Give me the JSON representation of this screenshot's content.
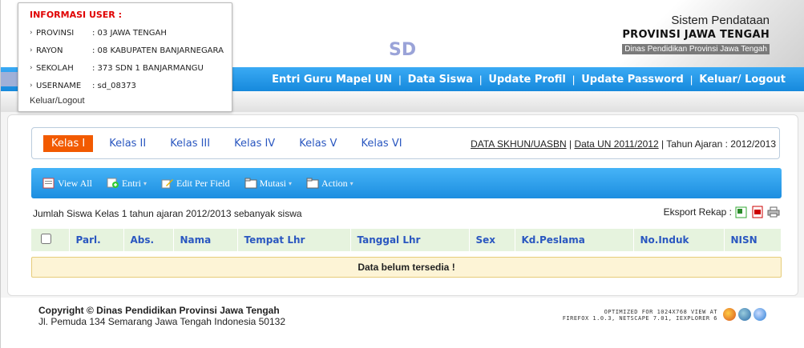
{
  "user_info": {
    "title": "INFORMASI USER :",
    "rows": [
      {
        "label": "PROVINSI",
        "value": ": 03 JAWA TENGAH"
      },
      {
        "label": "RAYON",
        "value": ": 08 KABUPATEN BANJARNEGARA"
      },
      {
        "label": "SEKOLAH",
        "value": ": 373 SDN 1 BANJARMANGU"
      },
      {
        "label": "USERNAME",
        "value": ": sd_08373"
      }
    ],
    "logout_label": "Keluar/Logout"
  },
  "header": {
    "logo_text": "SD",
    "brand_line1": "Sistem Pendataan",
    "brand_line2": "PROVINSI JAWA TENGAH",
    "brand_line3": "Dinas Pendidikan Provinsi Jawa Tengah"
  },
  "top_menu": [
    "Entri Guru Mapel UN",
    "Data Siswa",
    "Update Profil",
    "Update Password",
    "Keluar/ Logout"
  ],
  "tabs": {
    "items": [
      "Kelas I",
      "Kelas II",
      "Kelas III",
      "Kelas IV",
      "Kelas V",
      "Kelas VI"
    ],
    "active_index": 0,
    "links": [
      "DATA SKHUN/UASBN",
      "Data UN 2011/2012"
    ],
    "year_label": "Tahun Ajaran : 2012/2013"
  },
  "toolbar": {
    "view_all": "View All",
    "entri": "Entri",
    "edit_per_field": "Edit Per Field",
    "mutasi": "Mutasi",
    "action": "Action"
  },
  "summary": {
    "count_text": "Jumlah Siswa Kelas 1 tahun ajaran 2012/2013 sebanyak siswa",
    "eksport_label": "Eksport Rekap :"
  },
  "table": {
    "columns": [
      "Parl.",
      "Abs.",
      "Nama",
      "Tempat Lhr",
      "Tanggal Lhr",
      "Sex",
      "Kd.Peslama",
      "No.Induk",
      "NISN"
    ],
    "empty_message": "Data belum tersedia !"
  },
  "footer": {
    "copyright": "Copyright © Dinas Pendidikan Provinsi Jawa Tengah",
    "address": "Jl. Pemuda 134 Semarang Jawa Tengah Indonesia 50132",
    "optimized_line1": "OPTIMIZED FOR 1024X768 VIEW AT",
    "optimized_line2": "FIREFOX 1.0.3, NETSCAPE 7.01, IEXPLORER 6"
  },
  "colors": {
    "accent_blue": "#1c8ee0",
    "active_tab": "#f25a00",
    "empty_row_bg": "#fdf4d6",
    "user_title": "#e00000"
  }
}
